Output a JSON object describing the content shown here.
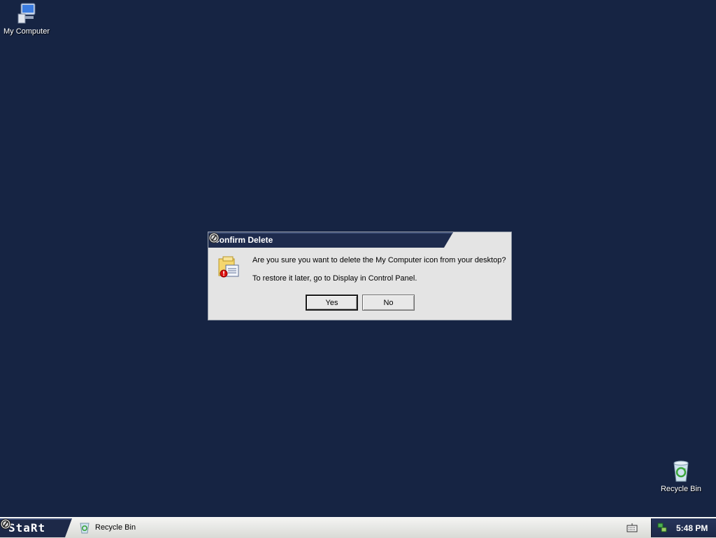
{
  "desktop": {
    "icons": [
      {
        "label": "My Computer",
        "icon": "my-computer-icon"
      },
      {
        "label": "Recycle Bin",
        "icon": "recycle-bin-icon"
      }
    ]
  },
  "dialog": {
    "title": "Confirm Delete",
    "message": "Are you sure you want to delete the My Computer icon from your desktop?",
    "hint": "To restore it later, go to Display in Control Panel.",
    "yes_label": "Yes",
    "no_label": "No"
  },
  "taskbar": {
    "start_label": "StaRt",
    "tasks": [
      {
        "label": "Recycle Bin",
        "icon": "recycle-bin-icon"
      }
    ],
    "clock": "5:48 PM"
  },
  "colors": {
    "desktop_bg": "#162443",
    "titlebar": "#1e2b4d",
    "dialog_bg": "#e4e4e4"
  }
}
